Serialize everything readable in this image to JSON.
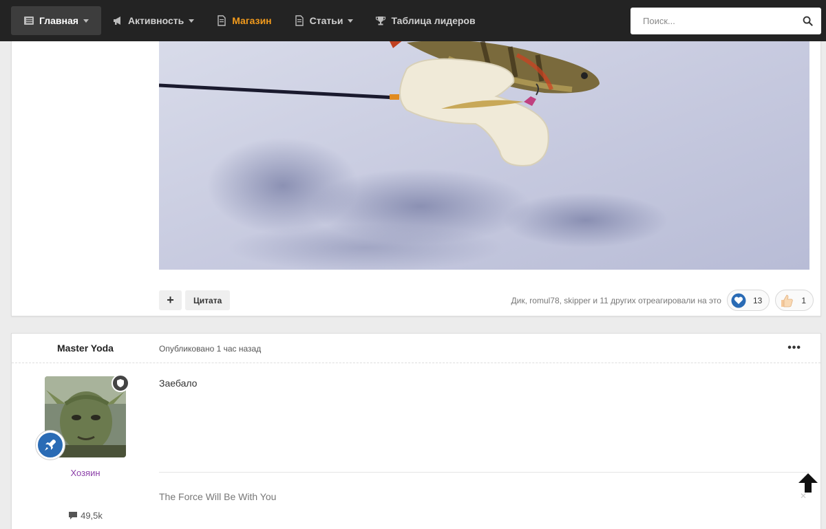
{
  "nav": {
    "items": [
      {
        "label": "Главная",
        "icon": "list-icon",
        "dropdown": true,
        "active": true
      },
      {
        "label": "Активность",
        "icon": "megaphone-icon",
        "dropdown": true
      },
      {
        "label": "Магазин",
        "icon": "document-icon",
        "dropdown": false,
        "highlight": "#f39b1c"
      },
      {
        "label": "Статьи",
        "icon": "document-icon",
        "dropdown": true
      },
      {
        "label": "Таблица лидеров",
        "icon": "trophy-icon",
        "dropdown": false
      }
    ],
    "search_placeholder": "Поиск..."
  },
  "post1": {
    "image_description": "perch-on-ice-with-fishing-rod",
    "actions": {
      "plus_label": "+",
      "quote_label": "Цитата"
    },
    "reactions_text": "Дик, romul78, skipper и 11 других отреагировали на это",
    "reactions": [
      {
        "icon": "heart-icon",
        "count": "13"
      },
      {
        "icon": "thumbs-up-icon",
        "count": "1"
      }
    ]
  },
  "post2": {
    "author": "Master Yoda",
    "date": "Опубликовано 1 час назад",
    "menu_label": "•••",
    "group": "Хозяин",
    "post_count": "49,5k",
    "body": "Заебало",
    "signature": "The Force Will Be With You",
    "signature_close": "✕"
  },
  "colors": {
    "accent": "#f39b1c",
    "group": "#8b3fa8",
    "rank_badge": "#2a6bb5",
    "heart": "#2a6bb5"
  }
}
